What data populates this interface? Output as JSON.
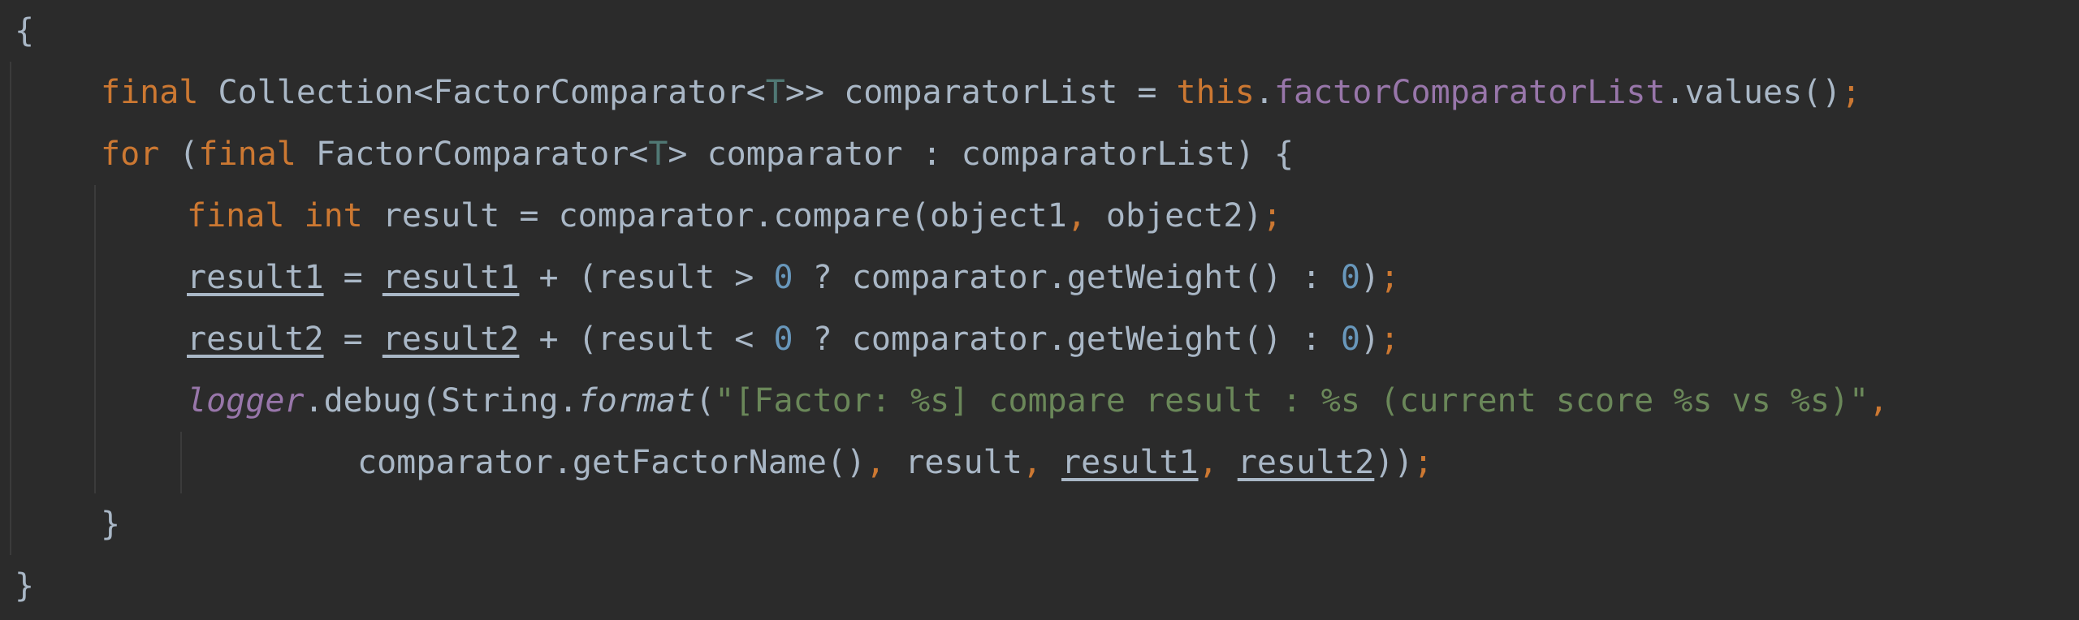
{
  "lines": [
    {
      "tokens": [
        {
          "t": "{",
          "c": "plain"
        }
      ]
    },
    {
      "tokens": [
        {
          "t": "final ",
          "c": "kw"
        },
        {
          "t": "Collection<FactorComparator<",
          "c": "plain"
        },
        {
          "t": "T",
          "c": "tp"
        },
        {
          "t": ">> comparatorList = ",
          "c": "plain"
        },
        {
          "t": "this",
          "c": "kw"
        },
        {
          "t": ".",
          "c": "plain"
        },
        {
          "t": "factorComparatorList",
          "c": "fld"
        },
        {
          "t": ".values()",
          "c": "plain"
        },
        {
          "t": ";",
          "c": "punc"
        }
      ]
    },
    {
      "tokens": [
        {
          "t": "for ",
          "c": "kw"
        },
        {
          "t": "(",
          "c": "plain"
        },
        {
          "t": "final ",
          "c": "kw"
        },
        {
          "t": "FactorComparator<",
          "c": "plain"
        },
        {
          "t": "T",
          "c": "tp"
        },
        {
          "t": "> comparator : comparatorList) {",
          "c": "plain"
        }
      ]
    },
    {
      "tokens": [
        {
          "t": "final ",
          "c": "kw"
        },
        {
          "t": "int ",
          "c": "kw"
        },
        {
          "t": "result = comparator.compare(object1",
          "c": "plain"
        },
        {
          "t": ", ",
          "c": "punc"
        },
        {
          "t": "object2)",
          "c": "plain"
        },
        {
          "t": ";",
          "c": "punc"
        }
      ]
    },
    {
      "tokens": [
        {
          "t": "result1",
          "c": "plain ul"
        },
        {
          "t": " = ",
          "c": "plain"
        },
        {
          "t": "result1",
          "c": "plain ul"
        },
        {
          "t": " + (result > ",
          "c": "plain"
        },
        {
          "t": "0",
          "c": "num"
        },
        {
          "t": " ? comparator.getWeight() : ",
          "c": "plain"
        },
        {
          "t": "0",
          "c": "num"
        },
        {
          "t": ")",
          "c": "plain"
        },
        {
          "t": ";",
          "c": "punc"
        }
      ]
    },
    {
      "tokens": [
        {
          "t": "result2",
          "c": "plain ul"
        },
        {
          "t": " = ",
          "c": "plain"
        },
        {
          "t": "result2",
          "c": "plain ul"
        },
        {
          "t": " + (result < ",
          "c": "plain"
        },
        {
          "t": "0",
          "c": "num"
        },
        {
          "t": " ? comparator.getWeight() : ",
          "c": "plain"
        },
        {
          "t": "0",
          "c": "num"
        },
        {
          "t": ")",
          "c": "plain"
        },
        {
          "t": ";",
          "c": "punc"
        }
      ]
    },
    {
      "tokens": [
        {
          "t": "logger",
          "c": "static"
        },
        {
          "t": ".debug(String.",
          "c": "plain"
        },
        {
          "t": "format",
          "c": "plain it"
        },
        {
          "t": "(",
          "c": "plain"
        },
        {
          "t": "\"[Factor: %s] compare result : %s (current score %s vs %s)\"",
          "c": "str"
        },
        {
          "t": ",",
          "c": "punc"
        }
      ]
    },
    {
      "tokens": [
        {
          "t": "comparator.getFactorName()",
          "c": "plain"
        },
        {
          "t": ", ",
          "c": "punc"
        },
        {
          "t": "result",
          "c": "plain"
        },
        {
          "t": ", ",
          "c": "punc"
        },
        {
          "t": "result1",
          "c": "plain ul"
        },
        {
          "t": ", ",
          "c": "punc"
        },
        {
          "t": "result2",
          "c": "plain ul"
        },
        {
          "t": "))",
          "c": "plain"
        },
        {
          "t": ";",
          "c": "punc"
        }
      ]
    },
    {
      "tokens": [
        {
          "t": "}",
          "c": "plain"
        }
      ]
    },
    {
      "tokens": [
        {
          "t": "}",
          "c": "plain"
        }
      ]
    }
  ]
}
